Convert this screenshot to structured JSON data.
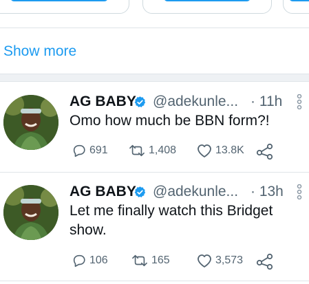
{
  "show_more": {
    "label": "Show more"
  },
  "colors": {
    "accent": "#1d9bf0",
    "muted": "#536471",
    "text": "#0f1419"
  },
  "tweets": [
    {
      "name": "AG BABY",
      "handle": "@adekunle...",
      "time": "· 11h",
      "text": "Omo how much be BBN form?!",
      "replies": "691",
      "retweets": "1,408",
      "likes": "13.8K",
      "icons": [
        "verified-badge-icon",
        "more-icon",
        "reply-icon",
        "retweet-icon",
        "like-icon",
        "share-icon"
      ]
    },
    {
      "name": "AG BABY",
      "handle": "@adekunle...",
      "time": "· 13h",
      "text": "Let me finally watch this Bridget show.",
      "replies": "106",
      "retweets": "165",
      "likes": "3,573",
      "icons": [
        "verified-badge-icon",
        "more-icon",
        "reply-icon",
        "retweet-icon",
        "like-icon",
        "share-icon"
      ]
    }
  ]
}
